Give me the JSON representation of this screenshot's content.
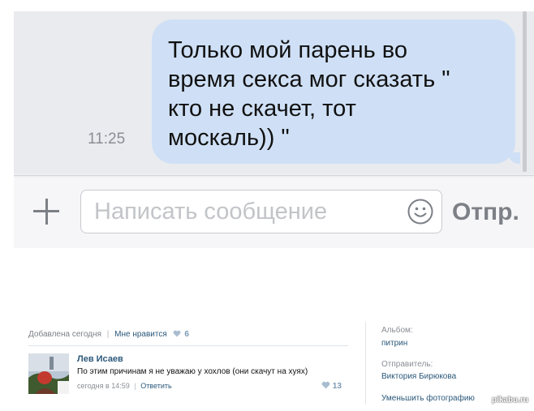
{
  "chat": {
    "message": "Только мой парень во\nвремя секса мог сказать \"\nкто не скачет, тот\nмоскаль)) \"",
    "time": "11:25",
    "composer": {
      "placeholder": "Написать сообщение",
      "send_label": "Отпр.",
      "plus_icon": "plus-icon",
      "smiley_icon": "smiley-icon"
    }
  },
  "photo_panel": {
    "added": "Добавлена сегодня",
    "like_label": "Мне нравится",
    "like_count": "6",
    "comment": {
      "author": "Лев Исаев",
      "text": "По этим причинам я не уважаю у хохлов (они скачут на хуях)",
      "time": "сегодня в 14:59",
      "reply_label": "Ответить",
      "likes": "13"
    },
    "sidebar": {
      "album_label": "Альбом:",
      "album_name": "питрин",
      "sender_label": "Отправитель:",
      "sender_name": "Виктория Бирюкова",
      "shrink_label": "Уменьшить фотографию"
    },
    "watermark": "pikabu.ru"
  },
  "colors": {
    "bubble": "#cfe0f6",
    "link": "#2b587a",
    "heart": "#a9bdd0"
  }
}
